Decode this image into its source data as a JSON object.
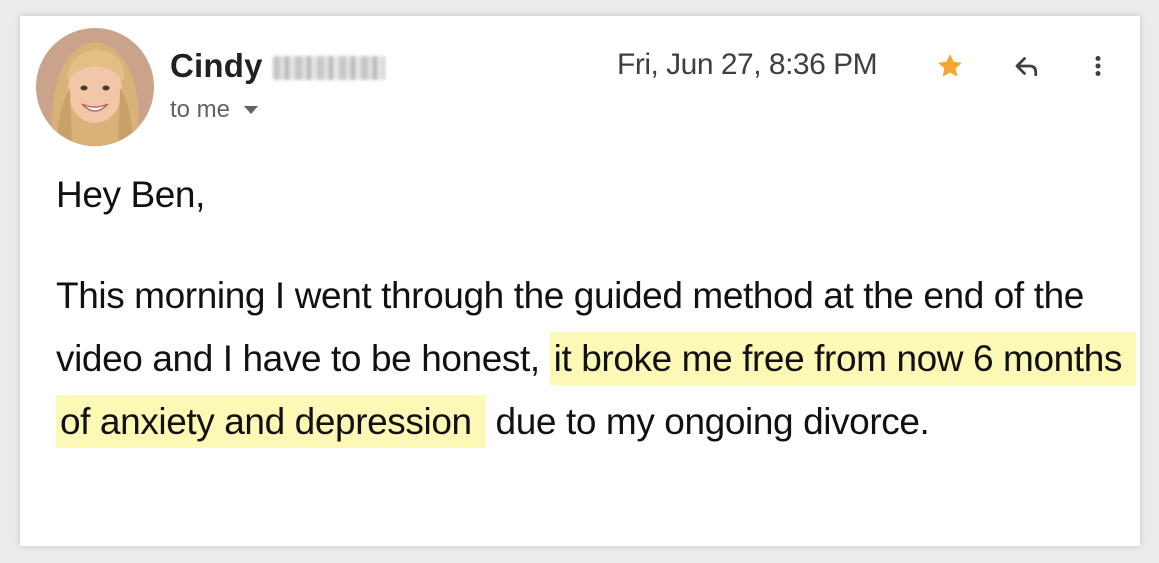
{
  "email": {
    "sender": {
      "first_name": "Cindy",
      "last_name_redacted": true
    },
    "recipient_label": "to me",
    "date": "Fri, Jun 27, 8:36 PM",
    "starred": true,
    "icons": {
      "star": "star-icon",
      "reply": "reply-icon",
      "more": "more-vert-icon",
      "dropdown": "chevron-down-icon"
    },
    "colors": {
      "star": "#F4A630",
      "highlight": "#FCF8B6",
      "secondary_text": "#5F6368"
    },
    "body": {
      "greeting": "Hey Ben,",
      "paragraph": {
        "before_highlight": "This morning I went through the guided method at the end of the video and I have to be honest, ",
        "highlight": "it broke me free from now 6 months of anxiety and depression",
        "after_highlight": " due to my ongoing divorce."
      }
    }
  }
}
